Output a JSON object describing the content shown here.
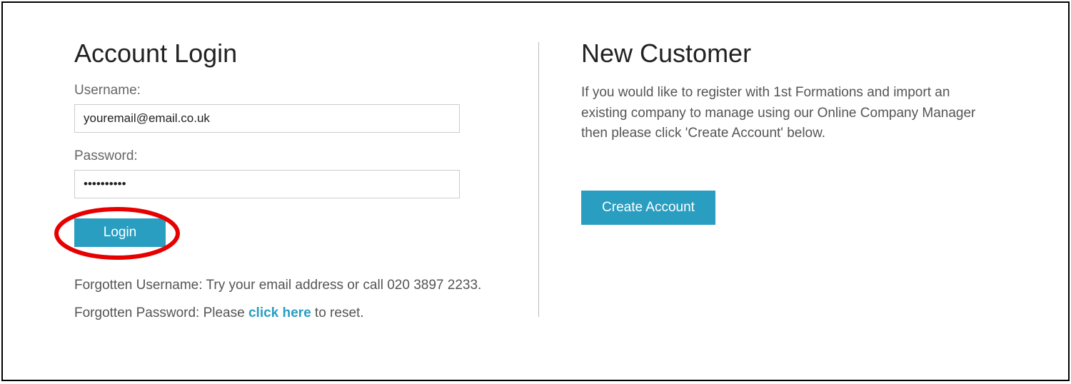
{
  "login": {
    "heading": "Account Login",
    "username_label": "Username:",
    "username_value": "youremail@email.co.uk",
    "password_label": "Password:",
    "password_value": "••••••••••",
    "login_button": "Login",
    "forgot_username_text": "Forgotten Username: Try your email address or call 020 3897 2233.",
    "forgot_password_prefix": "Forgotten Password: Please ",
    "forgot_password_link": "click here",
    "forgot_password_suffix": " to reset."
  },
  "new_customer": {
    "heading": "New Customer",
    "description": "If you would like to register with 1st Formations and import an existing company to manage using our Online Company Manager then please click 'Create Account' below.",
    "create_button": "Create Account"
  },
  "colors": {
    "accent": "#2a9ec1",
    "annotation": "#e60000"
  }
}
